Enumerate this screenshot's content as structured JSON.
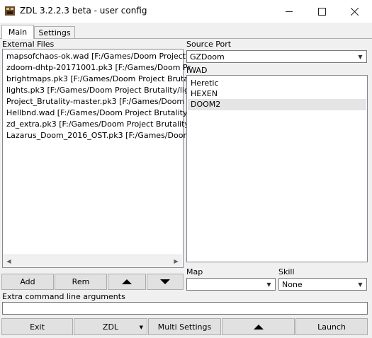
{
  "window": {
    "title": "ZDL 3.2.2.3 beta - user config"
  },
  "tabs": [
    {
      "label": "Main"
    },
    {
      "label": "Settings"
    }
  ],
  "external_files": {
    "label": "External Files",
    "items": [
      "mapsofchaos-ok.wad [F:/Games/Doom Project",
      "zdoom-dhtp-20171001.pk3 [F:/Games/Doom Pr",
      "brightmaps.pk3 [F:/Games/Doom Project Bruta",
      "lights.pk3 [F:/Games/Doom Project Brutality/lig",
      "Project_Brutality-master.pk3 [F:/Games/Doom P",
      "Hellbnd.wad [F:/Games/Doom Project Brutality,",
      "zd_extra.pk3 [F:/Games/Doom Project Brutality/",
      "Lazarus_Doom_2016_OST.pk3 [F:/Games/Doom"
    ]
  },
  "source_port": {
    "label": "Source Port",
    "value": "GZDoom"
  },
  "iwad": {
    "label": "IWAD",
    "items": [
      "Heretic",
      "HEXEN",
      "DOOM2"
    ],
    "selected": "DOOM2"
  },
  "file_buttons": {
    "add": "Add",
    "rem": "Rem"
  },
  "map": {
    "label": "Map",
    "value": ""
  },
  "skill": {
    "label": "Skill",
    "value": "None"
  },
  "extra_args": {
    "label": "Extra command line arguments",
    "value": ""
  },
  "bottom_bar": {
    "exit": "Exit",
    "zdl": "ZDL",
    "multi": "Multi Settings",
    "launch": "Launch"
  }
}
